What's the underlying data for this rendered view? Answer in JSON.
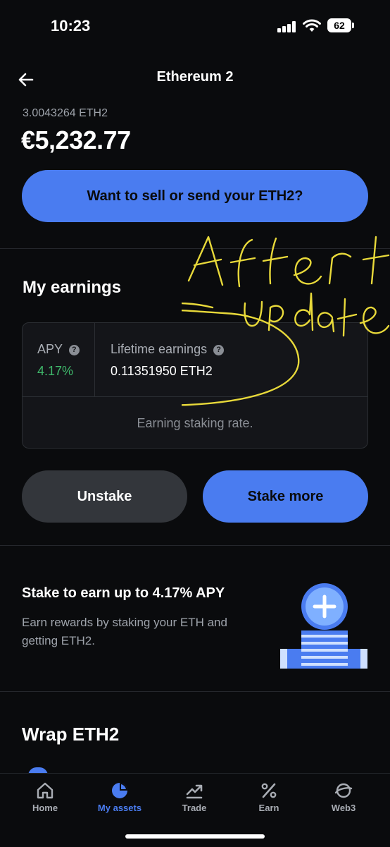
{
  "status_bar": {
    "time": "10:23",
    "battery": "62"
  },
  "header": {
    "title": "Ethereum 2"
  },
  "holding": {
    "amount": "3.0043264 ETH2",
    "value": "€5,232.77"
  },
  "actions": {
    "sell_send_label": "Want to sell or send your ETH2?",
    "unstake_label": "Unstake",
    "stake_more_label": "Stake more"
  },
  "earnings": {
    "title": "My earnings",
    "apy_label": "APY",
    "apy_value": "4.17%",
    "lifetime_label": "Lifetime earnings",
    "lifetime_value": "0.11351950 ETH2",
    "status_text": "Earning staking rate."
  },
  "promo": {
    "title": "Stake to earn up to 4.17% APY",
    "body": "Earn rewards by staking your ETH and getting ETH2."
  },
  "wrap": {
    "title": "Wrap ETH2"
  },
  "annotation": {
    "text": "After Update"
  },
  "nav": [
    {
      "label": "Home",
      "icon": "home-icon",
      "active": false
    },
    {
      "label": "My assets",
      "icon": "pie-chart-icon",
      "active": true
    },
    {
      "label": "Trade",
      "icon": "trend-up-icon",
      "active": false
    },
    {
      "label": "Earn",
      "icon": "percent-icon",
      "active": false
    },
    {
      "label": "Web3",
      "icon": "web3-icon",
      "active": false
    }
  ],
  "colors": {
    "accent": "#4a7cf0",
    "positive": "#3fb86b",
    "background": "#0a0b0d",
    "annotation": "#e8d93a"
  }
}
